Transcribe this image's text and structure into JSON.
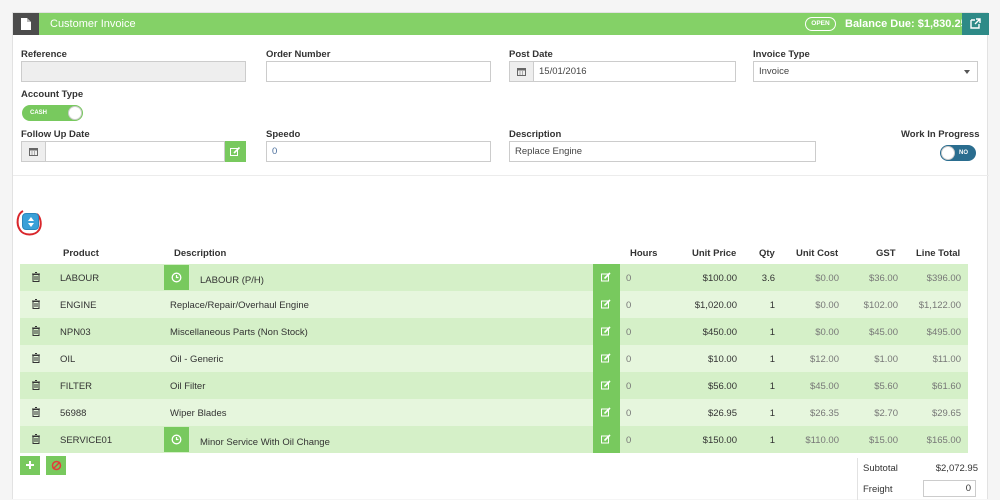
{
  "header": {
    "title": "Customer Invoice",
    "status_badge": "OPEN",
    "balance_due": "Balance Due: $1,830.25",
    "icons": {
      "document": "document-icon",
      "external": "external-link-icon"
    }
  },
  "form": {
    "reference": {
      "label": "Reference",
      "value": ""
    },
    "order_number": {
      "label": "Order Number",
      "value": ""
    },
    "post_date": {
      "label": "Post Date",
      "value": "15/01/2016"
    },
    "invoice_type": {
      "label": "Invoice Type",
      "value": "Invoice"
    },
    "account_type": {
      "label": "Account Type",
      "value": "CASH"
    },
    "follow_up_date": {
      "label": "Follow Up Date",
      "value": ""
    },
    "speedo": {
      "label": "Speedo",
      "value": "0"
    },
    "description": {
      "label": "Description",
      "value": "Replace Engine"
    },
    "work_in_progress": {
      "label": "Work In Progress",
      "value": "NO"
    }
  },
  "table": {
    "columns": [
      "Product",
      "Description",
      "Hours",
      "Unit Price",
      "Qty",
      "Unit Cost",
      "GST",
      "Line Total"
    ],
    "rows": [
      {
        "product": "LABOUR",
        "description": "LABOUR (P/H)",
        "hours": "0",
        "unit_price": "$100.00",
        "qty": "3.6",
        "unit_cost": "$0.00",
        "gst": "$36.00",
        "line_total": "$396.00",
        "timer": true
      },
      {
        "product": "ENGINE",
        "description": "Replace/Repair/Overhaul Engine",
        "hours": "0",
        "unit_price": "$1,020.00",
        "qty": "1",
        "unit_cost": "$0.00",
        "gst": "$102.00",
        "line_total": "$1,122.00",
        "timer": false
      },
      {
        "product": "NPN03",
        "description": "Miscellaneous Parts (Non Stock)",
        "hours": "0",
        "unit_price": "$450.00",
        "qty": "1",
        "unit_cost": "$0.00",
        "gst": "$45.00",
        "line_total": "$495.00",
        "timer": false
      },
      {
        "product": "OIL",
        "description": "Oil - Generic",
        "hours": "0",
        "unit_price": "$10.00",
        "qty": "1",
        "unit_cost": "$12.00",
        "gst": "$1.00",
        "line_total": "$11.00",
        "timer": false
      },
      {
        "product": "FILTER",
        "description": "Oil Filter",
        "hours": "0",
        "unit_price": "$56.00",
        "qty": "1",
        "unit_cost": "$45.00",
        "gst": "$5.60",
        "line_total": "$61.60",
        "timer": false
      },
      {
        "product": "56988",
        "description": "Wiper Blades",
        "hours": "0",
        "unit_price": "$26.95",
        "qty": "1",
        "unit_cost": "$26.35",
        "gst": "$2.70",
        "line_total": "$29.65",
        "timer": false
      },
      {
        "product": "SERVICE01",
        "description": "Minor Service With Oil Change",
        "hours": "0",
        "unit_price": "$150.00",
        "qty": "1",
        "unit_cost": "$110.00",
        "gst": "$15.00",
        "line_total": "$165.00",
        "timer": true
      }
    ]
  },
  "totals": {
    "subtotal_label": "Subtotal",
    "subtotal_value": "$2,072.95",
    "freight_label": "Freight",
    "freight_value": "0"
  },
  "colors": {
    "header_green": "#84d167",
    "row_green_dark": "#d5f0c8",
    "row_green_light": "#e6f6dd",
    "button_green": "#78c95e",
    "toggle_teal": "#2a6d8f",
    "sort_blue": "#3aa0d8",
    "annotation_red": "#d9262b"
  }
}
